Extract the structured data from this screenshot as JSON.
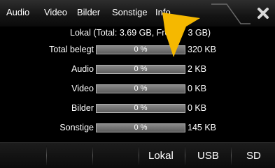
{
  "tabs": [
    {
      "label": "Audio"
    },
    {
      "label": "Video"
    },
    {
      "label": "Bilder"
    },
    {
      "label": "Sonstige"
    },
    {
      "label": "Info"
    }
  ],
  "close_icon": "close-x-icon",
  "summary": "Lokal (Total: 3.69 GB, Fre",
  "summary_tail": "3 GB)",
  "rows": [
    {
      "label": "Total belegt",
      "percent_text": "0 %",
      "size": "320 KB",
      "fill": 0
    },
    {
      "label": "Audio",
      "percent_text": "0 %",
      "size": "2 KB",
      "fill": 0
    },
    {
      "label": "Video",
      "percent_text": "0 %",
      "size": "0 KB",
      "fill": 0
    },
    {
      "label": "Bilder",
      "percent_text": "0 %",
      "size": "0 KB",
      "fill": 0
    },
    {
      "label": "Sonstige",
      "percent_text": "0 %",
      "size": "145 KB",
      "fill": 0
    }
  ],
  "bottom": {
    "lokal": "Lokal",
    "usb": "USB",
    "sd": "SD"
  },
  "colors": {
    "pointer": "#f5b800",
    "bar_fill": "#3a78c8"
  },
  "pointer_icon": "arrow-pointer-icon"
}
